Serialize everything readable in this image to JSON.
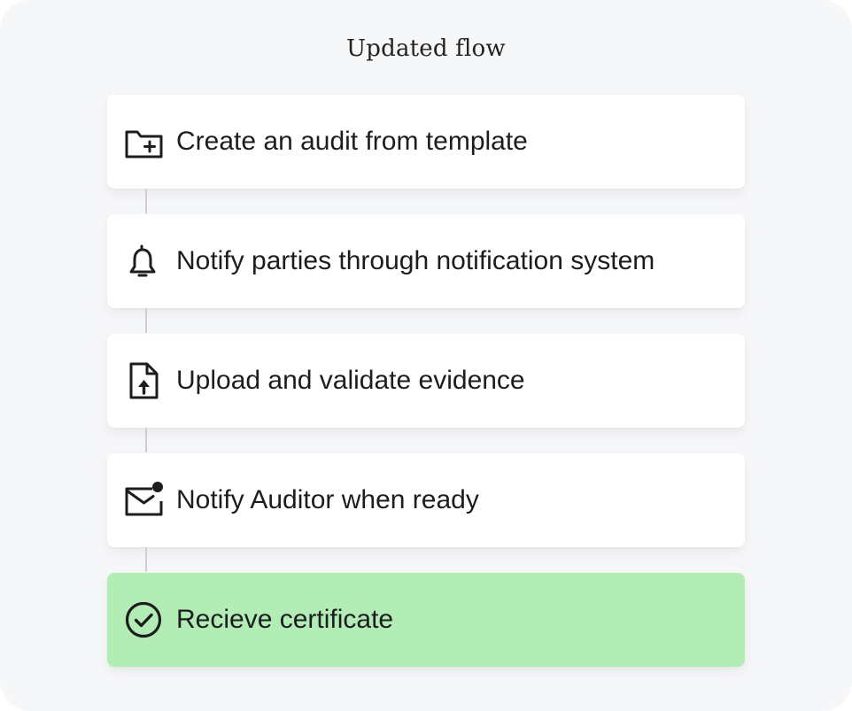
{
  "flow": {
    "title": "Updated flow",
    "steps": [
      {
        "label": "Create an audit from template",
        "icon": "folder-plus-icon",
        "state": "default"
      },
      {
        "label": "Notify parties through notification system",
        "icon": "bell-icon",
        "state": "default"
      },
      {
        "label": "Upload and validate evidence",
        "icon": "file-upload-icon",
        "state": "default"
      },
      {
        "label": "Notify Auditor when ready",
        "icon": "mail-notification-icon",
        "state": "default"
      },
      {
        "label": "Recieve certificate",
        "icon": "check-circle-icon",
        "state": "done"
      }
    ]
  },
  "colors": {
    "panel_background": "#f6f7f9",
    "card_background": "#ffffff",
    "done_background": "#b2edb6",
    "connector": "#cfcfd2",
    "icon": "#1d1d1f"
  }
}
